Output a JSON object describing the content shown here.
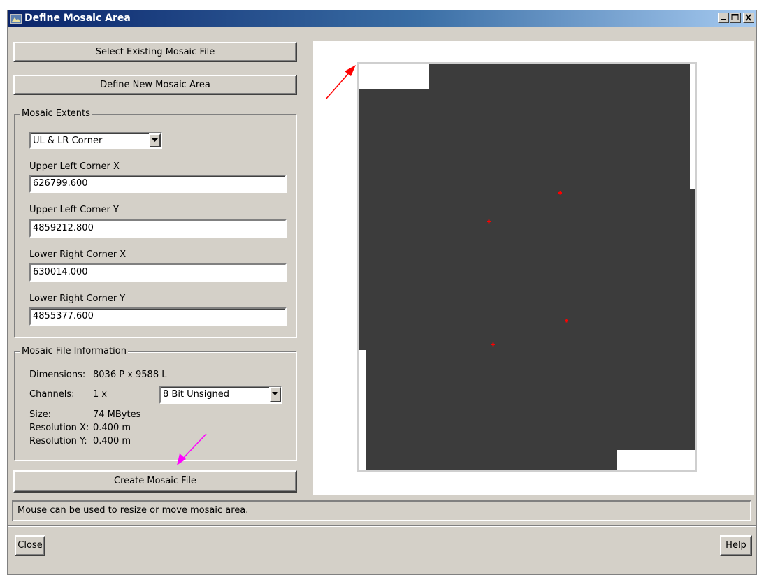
{
  "window": {
    "title": "Define Mosaic Area",
    "controls": [
      "minimize",
      "maximize",
      "close"
    ]
  },
  "buttons": {
    "select_existing": "Select Existing Mosaic File",
    "define_new": "Define New Mosaic Area",
    "create": "Create Mosaic File",
    "close": "Close",
    "help": "Help"
  },
  "extents": {
    "group_title": "Mosaic Extents",
    "mode": "UL & LR Corner",
    "ulx_label": "Upper Left Corner X",
    "ulx_value": "626799.600",
    "uly_label": "Upper Left Corner Y",
    "uly_value": "4859212.800",
    "lrx_label": "Lower Right Corner X",
    "lrx_value": "630014.000",
    "lry_label": "Lower Right Corner Y",
    "lry_value": "4855377.600"
  },
  "info": {
    "group_title": "Mosaic File Information",
    "dimensions_label": "Dimensions:",
    "dimensions_value": "8036 P x 9588 L",
    "channels_label": "Channels:",
    "channels_value": "1 x",
    "channel_type": "8 Bit Unsigned",
    "size_label": "Size:",
    "size_value": "74 MBytes",
    "resx_label": "Resolution X:",
    "resx_value": "0.400 m",
    "resy_label": "Resolution Y:",
    "resy_value": "0.400 m"
  },
  "status": "Mouse can be used to resize or move mosaic area.",
  "colors": {
    "mosaic_fill": "#3c3c3c",
    "marker": "#ff0000",
    "annotation_arrow_red": "#ff0000",
    "annotation_arrow_magenta": "#ff00ff"
  }
}
